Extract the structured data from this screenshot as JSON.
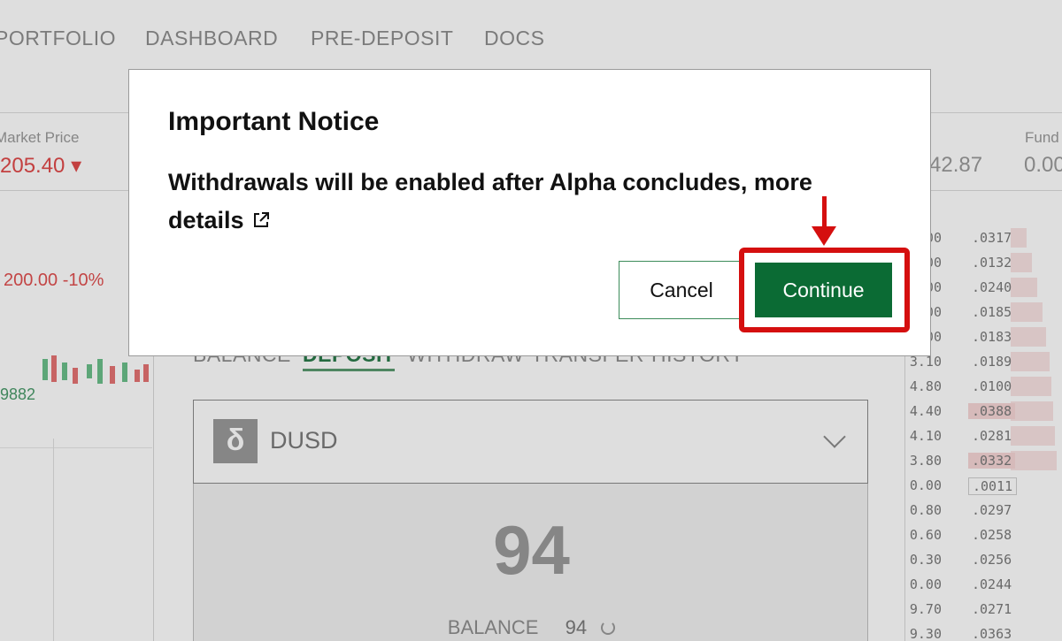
{
  "nav": {
    "items": [
      "PORTFOLIO",
      "DASHBOARD",
      "PRE-DEPOSIT",
      "DOCS"
    ]
  },
  "stats": {
    "market_price_label": "Market Price",
    "market_price_value": "205.40 ▾",
    "right_value": "42.87",
    "funding_label": "Fund",
    "funding_value": "0.00"
  },
  "chart": {
    "price_line": "200.00 -10%",
    "low_value": "9882"
  },
  "wallet": {
    "tabs": [
      "BALANCE",
      "DEPOSIT",
      "WITHDRAW",
      "TRANSFER",
      "HISTORY"
    ],
    "active_tab": "DEPOSIT",
    "token": {
      "symbol": "DUSD",
      "logo_glyph": "δ"
    },
    "amount": "94",
    "balance_label": "BALANCE",
    "balance_value": "94"
  },
  "orderbook": {
    "rows": [
      {
        "price": ".00",
        "size": ".0317"
      },
      {
        "price": ".00",
        "size": ".0132"
      },
      {
        "price": ".00",
        "size": ".0240"
      },
      {
        "price": ".00",
        "size": ".0185"
      },
      {
        "price": ".00",
        "size": ".0183"
      },
      {
        "price": "3.10",
        "size": ".0189"
      },
      {
        "price": "4.80",
        "size": ".0100"
      },
      {
        "price": "4.40",
        "size": ".0388"
      },
      {
        "price": "4.10",
        "size": ".0281"
      },
      {
        "price": "3.80",
        "size": ".0332"
      },
      {
        "price": "0.00",
        "size": ".0011"
      },
      {
        "price": "0.80",
        "size": ".0297"
      },
      {
        "price": "0.60",
        "size": ".0258"
      },
      {
        "price": "0.30",
        "size": ".0256"
      },
      {
        "price": "0.00",
        "size": ".0244"
      },
      {
        "price": "9.70",
        "size": ".0271"
      },
      {
        "price": "9.30",
        "size": ".0363"
      }
    ]
  },
  "modal": {
    "title": "Important Notice",
    "message": "Withdrawals will be enabled after Alpha concludes, more details",
    "cancel_label": "Cancel",
    "continue_label": "Continue"
  },
  "colors": {
    "primary_green": "#0b6b34",
    "annotation_red": "#d50f0f",
    "ask_red": "#e04a4a"
  }
}
